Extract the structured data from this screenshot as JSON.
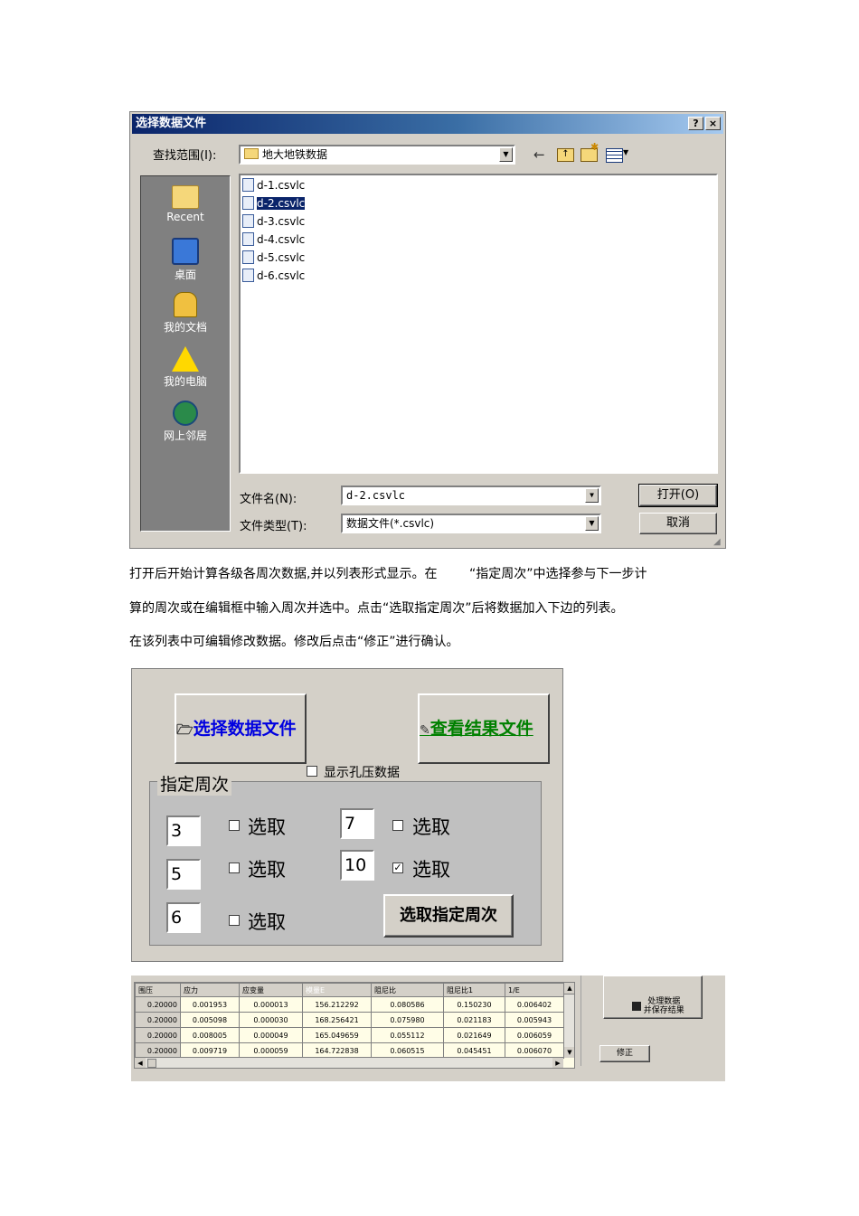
{
  "dialog": {
    "title": "选择数据文件",
    "help_btn": "?",
    "close_btn": "×",
    "look_in_label": "查找范围(I):",
    "look_in_value": "地大地铁数据",
    "places": [
      {
        "label": "Recent",
        "icon": "folder-icon"
      },
      {
        "label": "桌面",
        "icon": "desktop-icon"
      },
      {
        "label": "我的文档",
        "icon": "my-documents-icon"
      },
      {
        "label": "我的电脑",
        "icon": "my-computer-icon"
      },
      {
        "label": "网上邻居",
        "icon": "network-icon"
      }
    ],
    "files": [
      "d-1.csvlc",
      "d-2.csvlc",
      "d-3.csvlc",
      "d-4.csvlc",
      "d-5.csvlc",
      "d-6.csvlc"
    ],
    "selected_file": "d-2.csvlc",
    "filename_label": "文件名(N):",
    "filename_value": "d-2.csvlc",
    "filetype_label": "文件类型(T):",
    "filetype_value": "数据文件(*.csvlc)",
    "open_button": "打开(O)",
    "cancel_button": "取消"
  },
  "paragraphs": [
    "打开后开始计算各级各周次数据,并以列表形式显示。在        “指定周次”中选择参与下一步计",
    "算的周次或在编辑框中输入周次并选中。点击“选取指定周次”后将数据加入下边的列表。",
    "在该列表中可编辑修改数据。修改后点击“修正”进行确认。"
  ],
  "panel": {
    "select_file_button": "选择数据文件",
    "view_result_button": "查看结果文件",
    "show_pore_pressure_label": "显示孔压数据",
    "group_title": "指定周次",
    "cycles": [
      {
        "value": "3",
        "label": "选取",
        "checked": false
      },
      {
        "value": "7",
        "label": "选取",
        "checked": false
      },
      {
        "value": "5",
        "label": "选取",
        "checked": false
      },
      {
        "value": "10",
        "label": "选取",
        "checked": true
      },
      {
        "value": "6",
        "label": "选取",
        "checked": false
      }
    ],
    "select_cycles_button": "选取指定周次"
  },
  "grid": {
    "headers": [
      "围压",
      "应力",
      "应变量",
      "模量E",
      "阻尼比",
      "阻尼比1",
      "1/E"
    ],
    "rows": [
      [
        "0.20000",
        "0.001953",
        "0.000013",
        "156.212292",
        "0.080586",
        "0.150230",
        "0.006402"
      ],
      [
        "0.20000",
        "0.005098",
        "0.000030",
        "168.256421",
        "0.075980",
        "0.021183",
        "0.005943"
      ],
      [
        "0.20000",
        "0.008005",
        "0.000049",
        "165.049659",
        "0.055112",
        "0.021649",
        "0.006059"
      ],
      [
        "0.20000",
        "0.009719",
        "0.000059",
        "164.722838",
        "0.060515",
        "0.045451",
        "0.006070"
      ]
    ],
    "process_button": "处理数据\n并保存结果",
    "fix_button": "修正"
  }
}
